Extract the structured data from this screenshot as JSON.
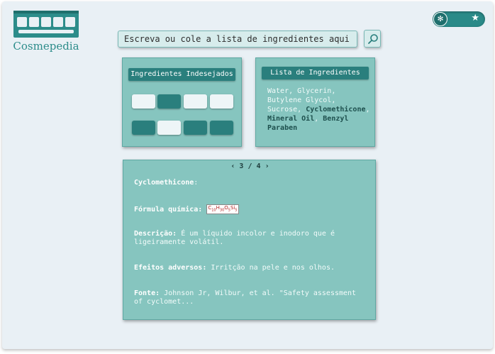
{
  "app": {
    "logo_text": "Cosmepedia",
    "accent_color": "#2a7f7d",
    "panel_color": "#86c5bf"
  },
  "theme_toggle": {
    "left_icon": "flower-icon",
    "right_icon": "star-icon",
    "left_glyph": "✻",
    "right_glyph": "★"
  },
  "search": {
    "placeholder": "Escreva ou cole a lista de ingredientes aqui",
    "button_icon": "search-icon"
  },
  "unwanted_panel": {
    "title": "Ingredientes Indesejados",
    "slots_row1": [
      "light",
      "dark",
      "light",
      "light"
    ],
    "slots_row2": [
      "dark",
      "light",
      "dark",
      "dark"
    ]
  },
  "ingredient_panel": {
    "title": "Lista de Ingredientes",
    "items": [
      {
        "text": "Water",
        "highlighted": false
      },
      {
        "text": "Glycerin",
        "highlighted": false
      },
      {
        "text": "Butylene Glycol",
        "highlighted": false
      },
      {
        "text": "Sucrose",
        "highlighted": false
      },
      {
        "text": "Cyclomethicone",
        "highlighted": true
      },
      {
        "text": "Mineral Oil",
        "highlighted": true
      },
      {
        "text": "Benzyl Paraben",
        "highlighted": true
      }
    ]
  },
  "detail_panel": {
    "pager": {
      "prev": "‹",
      "current": "3",
      "separator": "/",
      "total": "4",
      "next": "›"
    },
    "name": "Cyclomethicone",
    "name_suffix": ":",
    "formula_label": "Fórmula química:",
    "formula": {
      "C": "10",
      "H": "30",
      "O": "5",
      "Si": "5"
    },
    "description_label": "Descrição:",
    "description": "É um líquido incolor e inodoro que é ligeiramente volátil.",
    "adverse_label": "Efeitos adversos:",
    "adverse": "Irritção na pele e nos olhos.",
    "source_label": "Fonte:",
    "source": "Johnson Jr, Wilbur, et al. \"Safety assessment of cyclomet..."
  }
}
